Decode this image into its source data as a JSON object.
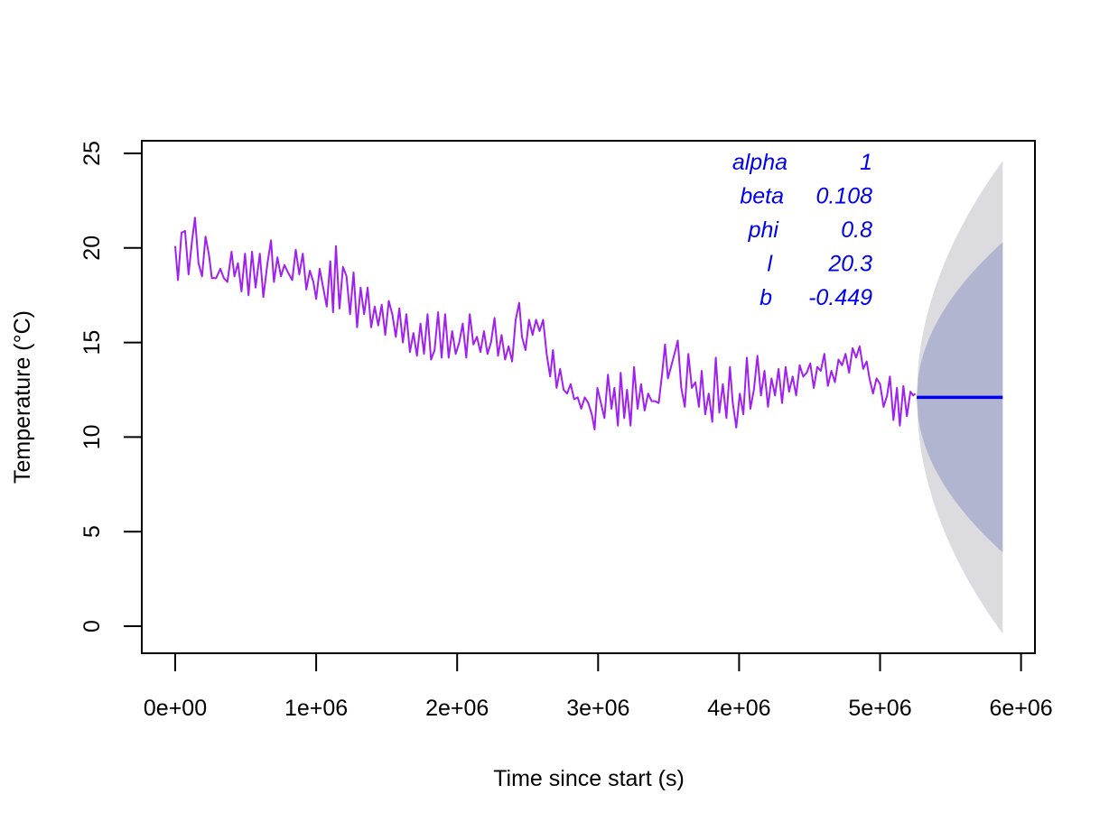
{
  "chart_data": {
    "type": "line",
    "title": "",
    "xlabel": "Time since start (s)",
    "ylabel": "Temperature (°C)",
    "xlim": [
      -240000,
      6100000
    ],
    "ylim": [
      -1.4,
      26.0
    ],
    "x_ticks": [
      0,
      1000000,
      2000000,
      3000000,
      4000000,
      5000000,
      6000000
    ],
    "x_tick_labels": [
      "0e+00",
      "1e+06",
      "2e+06",
      "3e+06",
      "4e+06",
      "5e+06",
      "6e+06"
    ],
    "y_ticks": [
      0,
      5,
      10,
      15,
      20,
      25
    ],
    "y_tick_labels": [
      "0",
      "5",
      "10",
      "15",
      "20",
      "25"
    ],
    "grid": false,
    "colors": {
      "observed": "#a020f0",
      "forecast": "#0000ee",
      "band_outer": "#dbdbe0",
      "band_inner": "#b1b5cf",
      "params_text": "#0000ee"
    },
    "series": [
      {
        "name": "observed",
        "x_unit": "s",
        "points": [
          [
            0,
            20.1
          ],
          [
            20000,
            18.3
          ],
          [
            45000,
            20.8
          ],
          [
            70000,
            20.9
          ],
          [
            95000,
            18.6
          ],
          [
            120000,
            20.4
          ],
          [
            140000,
            21.6
          ],
          [
            165000,
            19.2
          ],
          [
            190000,
            18.5
          ],
          [
            215000,
            20.6
          ],
          [
            240000,
            19.6
          ],
          [
            260000,
            18.4
          ],
          [
            290000,
            18.4
          ],
          [
            320000,
            18.9
          ],
          [
            345000,
            18.4
          ],
          [
            370000,
            18.2
          ],
          [
            400000,
            19.8
          ],
          [
            420000,
            18.5
          ],
          [
            445000,
            19.2
          ],
          [
            470000,
            17.7
          ],
          [
            495000,
            19.7
          ],
          [
            520000,
            17.5
          ],
          [
            545000,
            19.8
          ],
          [
            570000,
            17.9
          ],
          [
            600000,
            19.7
          ],
          [
            625000,
            17.4
          ],
          [
            655000,
            19.2
          ],
          [
            680000,
            20.4
          ],
          [
            700000,
            18.2
          ],
          [
            725000,
            19.5
          ],
          [
            750000,
            18.5
          ],
          [
            775000,
            19.1
          ],
          [
            800000,
            18.7
          ],
          [
            830000,
            18.3
          ],
          [
            855000,
            19.9
          ],
          [
            880000,
            18.6
          ],
          [
            905000,
            19.7
          ],
          [
            930000,
            17.8
          ],
          [
            955000,
            18.8
          ],
          [
            980000,
            18.2
          ],
          [
            1000000,
            17.3
          ],
          [
            1025000,
            18.9
          ],
          [
            1050000,
            17.9
          ],
          [
            1075000,
            16.9
          ],
          [
            1100000,
            19.3
          ],
          [
            1120000,
            16.6
          ],
          [
            1140000,
            20.1
          ],
          [
            1165000,
            16.8
          ],
          [
            1190000,
            19.0
          ],
          [
            1215000,
            18.5
          ],
          [
            1240000,
            16.5
          ],
          [
            1265000,
            18.7
          ],
          [
            1290000,
            15.8
          ],
          [
            1315000,
            17.9
          ],
          [
            1340000,
            16.5
          ],
          [
            1365000,
            17.9
          ],
          [
            1390000,
            15.8
          ],
          [
            1415000,
            16.9
          ],
          [
            1440000,
            15.9
          ],
          [
            1465000,
            17.0
          ],
          [
            1490000,
            15.4
          ],
          [
            1515000,
            17.2
          ],
          [
            1540000,
            16.5
          ],
          [
            1565000,
            15.3
          ],
          [
            1590000,
            16.8
          ],
          [
            1615000,
            15.0
          ],
          [
            1640000,
            16.5
          ],
          [
            1665000,
            14.5
          ],
          [
            1690000,
            15.5
          ],
          [
            1715000,
            14.3
          ],
          [
            1740000,
            16.0
          ],
          [
            1765000,
            14.4
          ],
          [
            1790000,
            16.5
          ],
          [
            1815000,
            14.1
          ],
          [
            1840000,
            14.6
          ],
          [
            1865000,
            16.6
          ],
          [
            1890000,
            14.2
          ],
          [
            1915000,
            16.5
          ],
          [
            1940000,
            14.2
          ],
          [
            1965000,
            15.6
          ],
          [
            1990000,
            14.4
          ],
          [
            2015000,
            15.0
          ],
          [
            2040000,
            16.0
          ],
          [
            2065000,
            14.2
          ],
          [
            2090000,
            16.5
          ],
          [
            2115000,
            14.9
          ],
          [
            2140000,
            15.3
          ],
          [
            2165000,
            14.5
          ],
          [
            2190000,
            15.6
          ],
          [
            2215000,
            14.4
          ],
          [
            2240000,
            15.0
          ],
          [
            2265000,
            16.3
          ],
          [
            2290000,
            14.3
          ],
          [
            2315000,
            15.4
          ],
          [
            2340000,
            14.1
          ],
          [
            2365000,
            14.8
          ],
          [
            2390000,
            14.0
          ],
          [
            2415000,
            16.2
          ],
          [
            2440000,
            17.1
          ],
          [
            2460000,
            15.3
          ],
          [
            2485000,
            14.6
          ],
          [
            2510000,
            16.2
          ],
          [
            2535000,
            15.4
          ],
          [
            2560000,
            16.2
          ],
          [
            2585000,
            15.6
          ],
          [
            2610000,
            16.2
          ],
          [
            2635000,
            14.4
          ],
          [
            2660000,
            13.2
          ],
          [
            2680000,
            14.6
          ],
          [
            2705000,
            12.6
          ],
          [
            2730000,
            13.6
          ],
          [
            2755000,
            12.5
          ],
          [
            2780000,
            12.3
          ],
          [
            2805000,
            12.8
          ],
          [
            2830000,
            12.0
          ],
          [
            2855000,
            12.1
          ],
          [
            2880000,
            11.5
          ],
          [
            2905000,
            12.1
          ],
          [
            2930000,
            11.8
          ],
          [
            2955000,
            11.2
          ],
          [
            2975000,
            10.4
          ],
          [
            2995000,
            12.6
          ],
          [
            3020000,
            11.8
          ],
          [
            3045000,
            11.0
          ],
          [
            3070000,
            13.3
          ],
          [
            3095000,
            11.5
          ],
          [
            3115000,
            12.6
          ],
          [
            3140000,
            10.6
          ],
          [
            3160000,
            13.4
          ],
          [
            3185000,
            11.0
          ],
          [
            3205000,
            12.5
          ],
          [
            3230000,
            10.6
          ],
          [
            3255000,
            13.7
          ],
          [
            3280000,
            11.5
          ],
          [
            3305000,
            12.8
          ],
          [
            3330000,
            11.4
          ],
          [
            3355000,
            12.3
          ],
          [
            3380000,
            11.9
          ],
          [
            3405000,
            11.9
          ],
          [
            3430000,
            11.8
          ],
          [
            3455000,
            13.4
          ],
          [
            3475000,
            14.9
          ],
          [
            3495000,
            13.1
          ],
          [
            3520000,
            13.8
          ],
          [
            3545000,
            14.5
          ],
          [
            3565000,
            15.1
          ],
          [
            3590000,
            12.6
          ],
          [
            3615000,
            11.6
          ],
          [
            3640000,
            14.4
          ],
          [
            3665000,
            12.6
          ],
          [
            3690000,
            12.9
          ],
          [
            3715000,
            11.6
          ],
          [
            3735000,
            13.5
          ],
          [
            3760000,
            11.2
          ],
          [
            3785000,
            12.3
          ],
          [
            3810000,
            10.8
          ],
          [
            3835000,
            14.2
          ],
          [
            3860000,
            11.3
          ],
          [
            3885000,
            12.8
          ],
          [
            3910000,
            11.0
          ],
          [
            3935000,
            13.7
          ],
          [
            3955000,
            11.8
          ],
          [
            3980000,
            10.5
          ],
          [
            4005000,
            12.3
          ],
          [
            4030000,
            11.2
          ],
          [
            4055000,
            14.2
          ],
          [
            4080000,
            11.5
          ],
          [
            4105000,
            12.5
          ],
          [
            4130000,
            14.3
          ],
          [
            4155000,
            12.2
          ],
          [
            4180000,
            13.5
          ],
          [
            4205000,
            11.6
          ],
          [
            4230000,
            13.1
          ],
          [
            4255000,
            12.2
          ],
          [
            4280000,
            13.6
          ],
          [
            4305000,
            11.8
          ],
          [
            4330000,
            13.7
          ],
          [
            4355000,
            12.4
          ],
          [
            4380000,
            13.2
          ],
          [
            4405000,
            12.2
          ],
          [
            4430000,
            13.8
          ],
          [
            4455000,
            13.2
          ],
          [
            4480000,
            13.4
          ],
          [
            4505000,
            13.9
          ],
          [
            4530000,
            12.6
          ],
          [
            4555000,
            13.7
          ],
          [
            4580000,
            13.5
          ],
          [
            4605000,
            14.4
          ],
          [
            4630000,
            12.7
          ],
          [
            4655000,
            13.5
          ],
          [
            4680000,
            12.9
          ],
          [
            4705000,
            14.1
          ],
          [
            4730000,
            13.8
          ],
          [
            4755000,
            14.4
          ],
          [
            4780000,
            13.4
          ],
          [
            4805000,
            14.7
          ],
          [
            4830000,
            14.2
          ],
          [
            4855000,
            14.8
          ],
          [
            4880000,
            13.6
          ],
          [
            4905000,
            14.0
          ],
          [
            4925000,
            13.1
          ],
          [
            4950000,
            12.3
          ],
          [
            4975000,
            13.1
          ],
          [
            5000000,
            12.8
          ],
          [
            5025000,
            11.6
          ],
          [
            5050000,
            12.2
          ],
          [
            5070000,
            13.2
          ],
          [
            5095000,
            10.9
          ],
          [
            5120000,
            12.6
          ],
          [
            5140000,
            10.6
          ],
          [
            5165000,
            12.7
          ],
          [
            5190000,
            11.1
          ],
          [
            5215000,
            12.4
          ],
          [
            5235000,
            12.2
          ],
          [
            5250000,
            12.3
          ]
        ]
      },
      {
        "name": "point forecast",
        "x": [
          5260000,
          5870000
        ],
        "y": [
          12.1,
          12.1
        ]
      }
    ],
    "bands": [
      {
        "name": "outer interval",
        "x": [
          5260000,
          5870000
        ],
        "center": 12.1,
        "half_width_end": 12.5
      },
      {
        "name": "inner interval",
        "x": [
          5260000,
          5870000
        ],
        "center": 12.1,
        "half_width_end": 8.2
      }
    ],
    "annotations": [
      {
        "label": "alpha",
        "value": "1"
      },
      {
        "label": "beta",
        "value": "0.108"
      },
      {
        "label": "phi",
        "value": "0.8"
      },
      {
        "label": "l",
        "value": "20.3"
      },
      {
        "label": "b",
        "value": "-0.449"
      }
    ]
  }
}
